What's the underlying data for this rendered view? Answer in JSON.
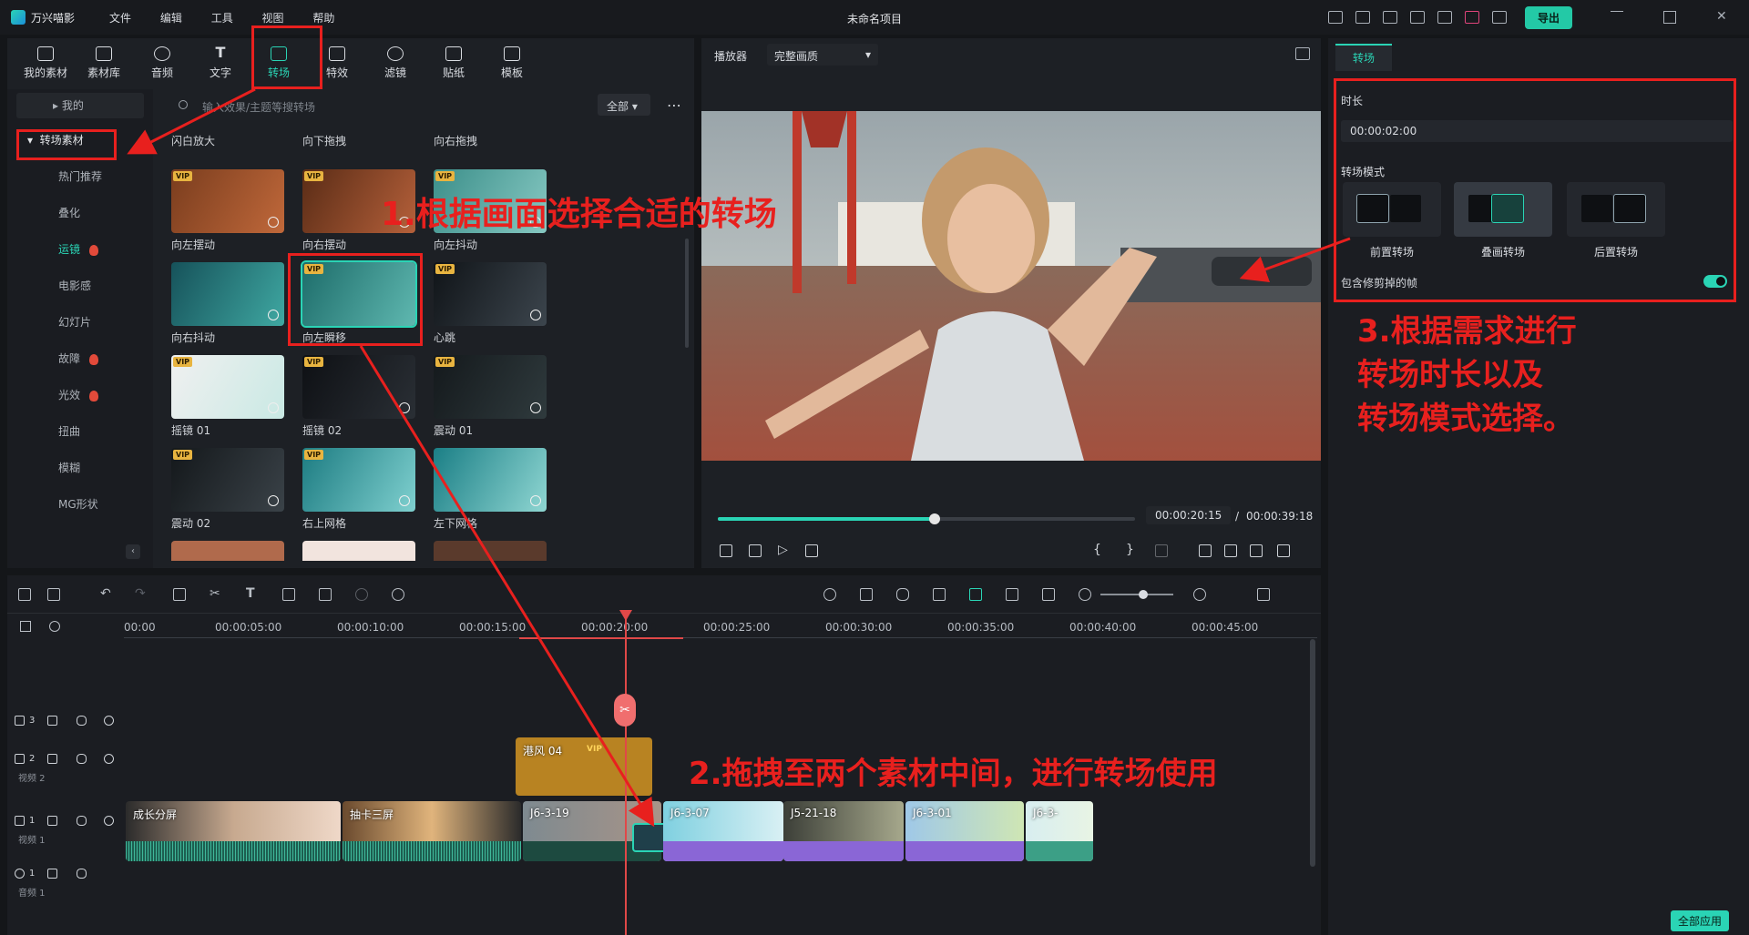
{
  "app": {
    "name": "万兴喵影",
    "project_title": "未命名项目",
    "menu": [
      "文件",
      "编辑",
      "工具",
      "视图",
      "帮助"
    ],
    "export_label": "导出"
  },
  "toolbar": {
    "items": [
      "我的素材",
      "素材库",
      "音频",
      "文字",
      "转场",
      "特效",
      "滤镜",
      "贴纸",
      "模板"
    ],
    "active": "转场"
  },
  "categories": {
    "mine": "我的",
    "group": "转场素材",
    "items": [
      {
        "label": "热门推荐",
        "hot": false
      },
      {
        "label": "叠化",
        "hot": false
      },
      {
        "label": "运镜",
        "hot": true,
        "active": true
      },
      {
        "label": "电影感",
        "hot": false
      },
      {
        "label": "幻灯片",
        "hot": false
      },
      {
        "label": "故障",
        "hot": true
      },
      {
        "label": "光效",
        "hot": true
      },
      {
        "label": "扭曲",
        "hot": false
      },
      {
        "label": "模糊",
        "hot": false
      },
      {
        "label": "MG形状",
        "hot": false
      }
    ]
  },
  "search": {
    "placeholder": "输入效果/主题等搜转场",
    "filter": "全部",
    "more": "⋯"
  },
  "transitions": [
    {
      "label": "闪白放大",
      "vip": false
    },
    {
      "label": "向下拖拽",
      "vip": false
    },
    {
      "label": "向右拖拽",
      "vip": false
    },
    {
      "label": "向左摆动",
      "vip": true
    },
    {
      "label": "向右摆动",
      "vip": true
    },
    {
      "label": "向左抖动",
      "vip": true
    },
    {
      "label": "向右抖动",
      "vip": false
    },
    {
      "label": "向左瞬移",
      "vip": true,
      "selected": true
    },
    {
      "label": "心跳",
      "vip": true
    },
    {
      "label": "摇镜 01",
      "vip": true
    },
    {
      "label": "摇镜 02",
      "vip": true
    },
    {
      "label": "震动 01",
      "vip": true
    },
    {
      "label": "震动 02",
      "vip": true
    },
    {
      "label": "右上网格",
      "vip": true
    },
    {
      "label": "左下网格",
      "vip": true
    }
  ],
  "player": {
    "label": "播放器",
    "quality": "完整画质",
    "current": "00:00:20:15",
    "separator": "/",
    "total": "00:00:39:18",
    "progress": 0.52
  },
  "props": {
    "tab": "转场",
    "duration_label": "时长",
    "duration_value": "00:00:02:00",
    "mode_label": "转场模式",
    "modes": [
      "前置转场",
      "叠画转场",
      "后置转场"
    ],
    "selected_mode": "叠画转场",
    "include_label": "包含修剪掉的帧",
    "include_on": true,
    "apply_all": "全部应用"
  },
  "timeline": {
    "ruler": [
      "00:00",
      "00:00:05:00",
      "00:00:10:00",
      "00:00:15:00",
      "00:00:20:00",
      "00:00:25:00",
      "00:00:30:00",
      "00:00:35:00",
      "00:00:40:00",
      "00:00:45:00"
    ],
    "tracks": [
      {
        "num": "3",
        "name": ""
      },
      {
        "num": "2",
        "name": "视频 2"
      },
      {
        "num": "1",
        "name": "视频 1"
      },
      {
        "num": "1",
        "name": "音频 1"
      }
    ],
    "clips_v2": [
      {
        "label": "港风 04"
      }
    ],
    "clips_v1": [
      {
        "label": "成长分屏"
      },
      {
        "label": "抽卡三屏"
      },
      {
        "label": "J6-3-19"
      },
      {
        "label": "J6-3-07"
      },
      {
        "label": "J5-21-18"
      },
      {
        "label": "J6-3-01"
      },
      {
        "label": "J6-3-"
      }
    ]
  },
  "annotations": {
    "step1": "1.根据画面选择合适的转场",
    "step2": "2.拖拽至两个素材中间，进行转场使用",
    "step3_l1": "3.根据需求进行",
    "step3_l2": "转场时长以及",
    "step3_l3": "转场模式选择。"
  },
  "colors": {
    "accent": "#2ad4b5",
    "annotation": "#e8201e",
    "vip": "#e8b440",
    "playhead": "#e04848"
  }
}
